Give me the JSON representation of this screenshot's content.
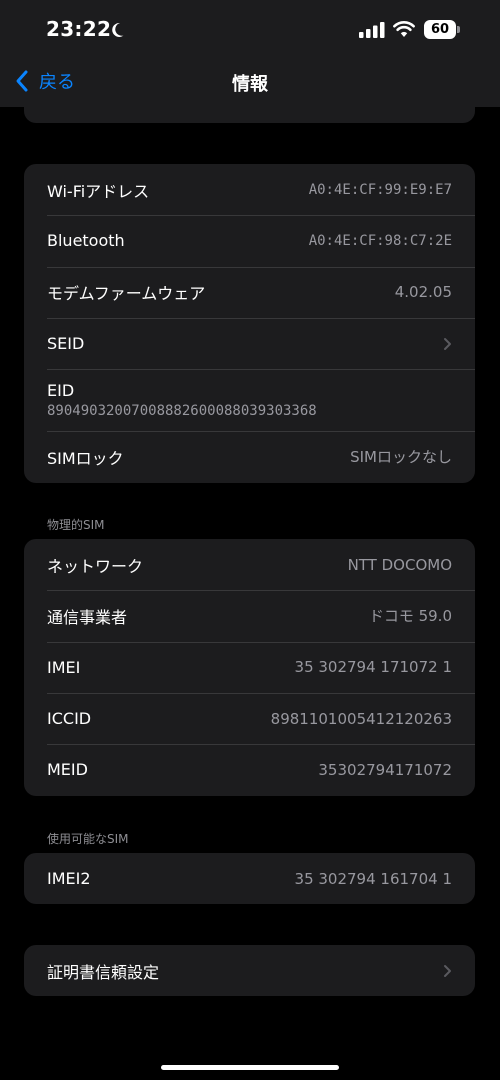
{
  "status_bar": {
    "time": "23:22",
    "battery": "60"
  },
  "nav": {
    "back_label": "戻る",
    "title": "情報"
  },
  "group1": {
    "wifi_label": "Wi-Fiアドレス",
    "wifi_value": "A0:4E:CF:99:E9:E7",
    "bluetooth_label": "Bluetooth",
    "bluetooth_value": "A0:4E:CF:98:C7:2E",
    "modem_label": "モデムファームウェア",
    "modem_value": "4.02.05",
    "seid_label": "SEID",
    "eid_label": "EID",
    "eid_value": "89049032007008882600088039303368",
    "simlock_label": "SIMロック",
    "simlock_value": "SIMロックなし"
  },
  "physical_sim": {
    "header": "物理的SIM",
    "network_label": "ネットワーク",
    "network_value": "NTT DOCOMO",
    "carrier_label": "通信事業者",
    "carrier_value": "ドコモ 59.0",
    "imei_label": "IMEI",
    "imei_value": "35 302794 171072 1",
    "iccid_label": "ICCID",
    "iccid_value": "8981101005412120263",
    "meid_label": "MEID",
    "meid_value": "35302794171072"
  },
  "available_sim": {
    "header": "使用可能なSIM",
    "imei2_label": "IMEI2",
    "imei2_value": "35 302794 161704 1"
  },
  "certificate": {
    "label": "証明書信頼設定"
  },
  "colors": {
    "accent": "#0a84ff",
    "background": "#000000",
    "card": "#1c1c1e",
    "secondary_text": "#98989f"
  }
}
